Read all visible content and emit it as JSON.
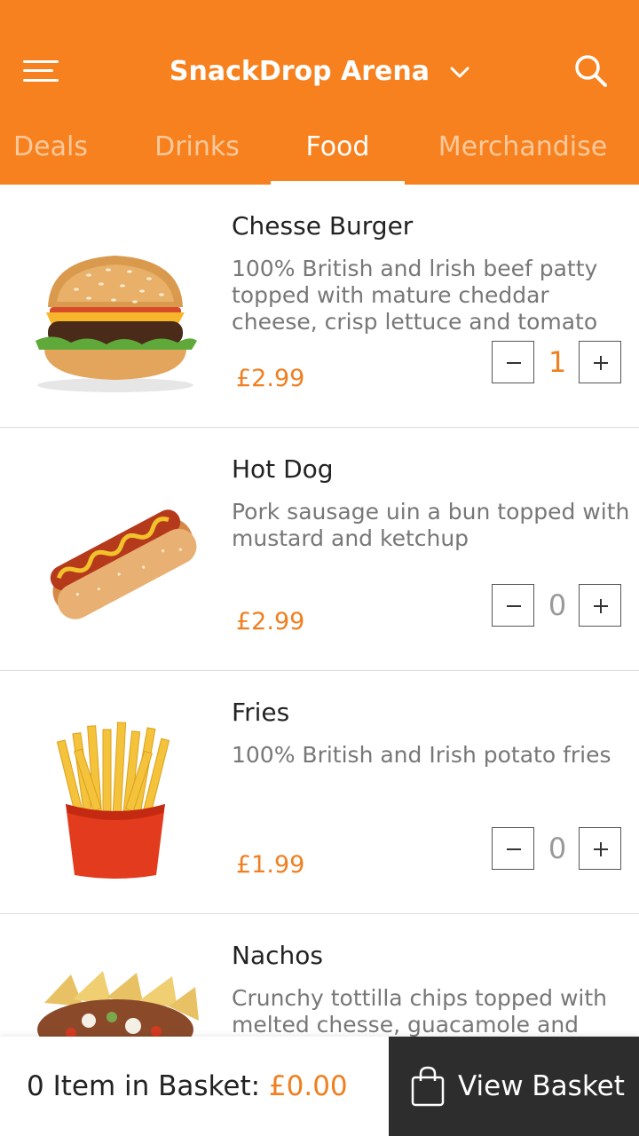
{
  "header": {
    "title": "SnackDrop Arena",
    "menu_icon": "hamburger-menu-icon",
    "dropdown_icon": "chevron-down-icon",
    "search_icon": "search-icon",
    "bg_color": "#f7811e"
  },
  "tabs": [
    {
      "label": "Deals",
      "active": false
    },
    {
      "label": "Drinks",
      "active": false
    },
    {
      "label": "Food",
      "active": true
    },
    {
      "label": "Merchandise",
      "active": false
    }
  ],
  "items": [
    {
      "name": "Chesse Burger",
      "description": "100% British and lrish beef patty topped with mature cheddar cheese, crisp lettuce and tomato",
      "price": "£2.99",
      "quantity": "1",
      "image": "cheeseburger"
    },
    {
      "name": "Hot Dog",
      "description": "Pork sausage uin a bun topped with mustard and ketchup",
      "price": "£2.99",
      "quantity": "0",
      "image": "hot-dog"
    },
    {
      "name": "Fries",
      "description": "100% British and Irish potato fries",
      "price": "£1.99",
      "quantity": "0",
      "image": "fries"
    },
    {
      "name": "Nachos",
      "description": "Crunchy tottilla chips topped with melted chesse, guacamole and mild",
      "image": "nachos"
    }
  ],
  "footer": {
    "basket_label": "0 Item in Basket: ",
    "basket_total": "£0.00",
    "view_basket_label": "View Basket",
    "bag_icon": "shopping-bag-icon"
  },
  "colors": {
    "accent": "#f07f20",
    "dark": "#2d2d2d"
  }
}
